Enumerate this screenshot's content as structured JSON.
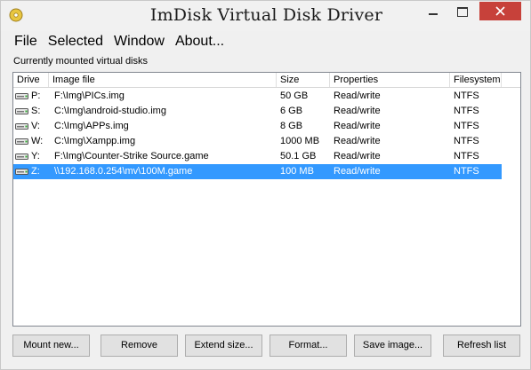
{
  "window": {
    "title": "ImDisk Virtual Disk Driver"
  },
  "menu": [
    "File",
    "Selected",
    "Window",
    "About..."
  ],
  "section_label": "Currently mounted virtual disks",
  "columns": [
    "Drive",
    "Image file",
    "Size",
    "Properties",
    "Filesystem"
  ],
  "rows": [
    {
      "drive": "P:",
      "image": "F:\\Img\\PICs.img",
      "size": "50 GB",
      "properties": "Read/write",
      "filesystem": "NTFS",
      "selected": false
    },
    {
      "drive": "S:",
      "image": "C:\\Img\\android-studio.img",
      "size": "6 GB",
      "properties": "Read/write",
      "filesystem": "NTFS",
      "selected": false
    },
    {
      "drive": "V:",
      "image": "C:\\Img\\APPs.img",
      "size": "8 GB",
      "properties": "Read/write",
      "filesystem": "NTFS",
      "selected": false
    },
    {
      "drive": "W:",
      "image": "C:\\Img\\Xampp.img",
      "size": "1000 MB",
      "properties": "Read/write",
      "filesystem": "NTFS",
      "selected": false
    },
    {
      "drive": "Y:",
      "image": "F:\\Img\\Counter-Strike Source.game",
      "size": "50.1 GB",
      "properties": "Read/write",
      "filesystem": "NTFS",
      "selected": false
    },
    {
      "drive": "Z:",
      "image": "\\\\192.168.0.254\\mv\\100M.game",
      "size": "100 MB",
      "properties": "Read/write",
      "filesystem": "NTFS",
      "selected": true
    }
  ],
  "buttons": {
    "mount_new": "Mount new...",
    "remove": "Remove",
    "extend_size": "Extend size...",
    "format": "Format...",
    "save_image": "Save image...",
    "refresh_list": "Refresh list"
  },
  "colors": {
    "selection": "#3399ff",
    "close_button": "#c7413a"
  },
  "icons": {
    "app": "disk-cd-icon",
    "drive": "drive-icon"
  }
}
